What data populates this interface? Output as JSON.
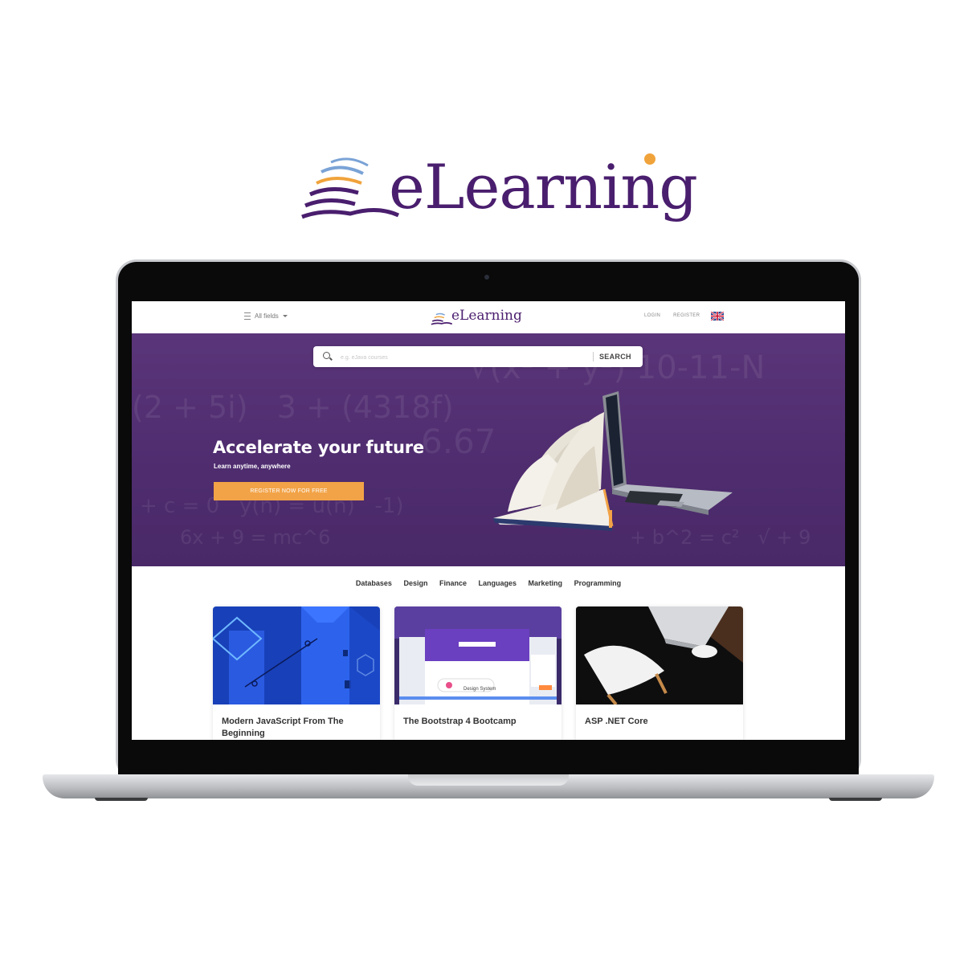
{
  "brand": {
    "name": "eLearning",
    "accent": "#4a1e6e",
    "dot_color": "#f0a33b"
  },
  "topnav": {
    "fields_label": "All fields",
    "logo_text": "eLearning",
    "login": "LOGIN",
    "register": "REGISTER",
    "language_flag": "uk-flag-icon"
  },
  "search": {
    "placeholder": "e.g. eJava courses",
    "button": "SEARCH"
  },
  "hero": {
    "title": "Accelerate your future",
    "subtitle": "Learn anytime, anywhere",
    "cta": "REGISTER NOW FOR FREE",
    "background": "#4e2c6e",
    "cta_color": "#f2a347"
  },
  "categories": [
    "Databases",
    "Design",
    "Finance",
    "Languages",
    "Marketing",
    "Programming"
  ],
  "courses": [
    {
      "title": "Modern JavaScript From The Beginning"
    },
    {
      "title": "The Bootstrap 4 Bootcamp",
      "thumb_caption": "Design System"
    },
    {
      "title": "ASP .NET Core"
    }
  ]
}
